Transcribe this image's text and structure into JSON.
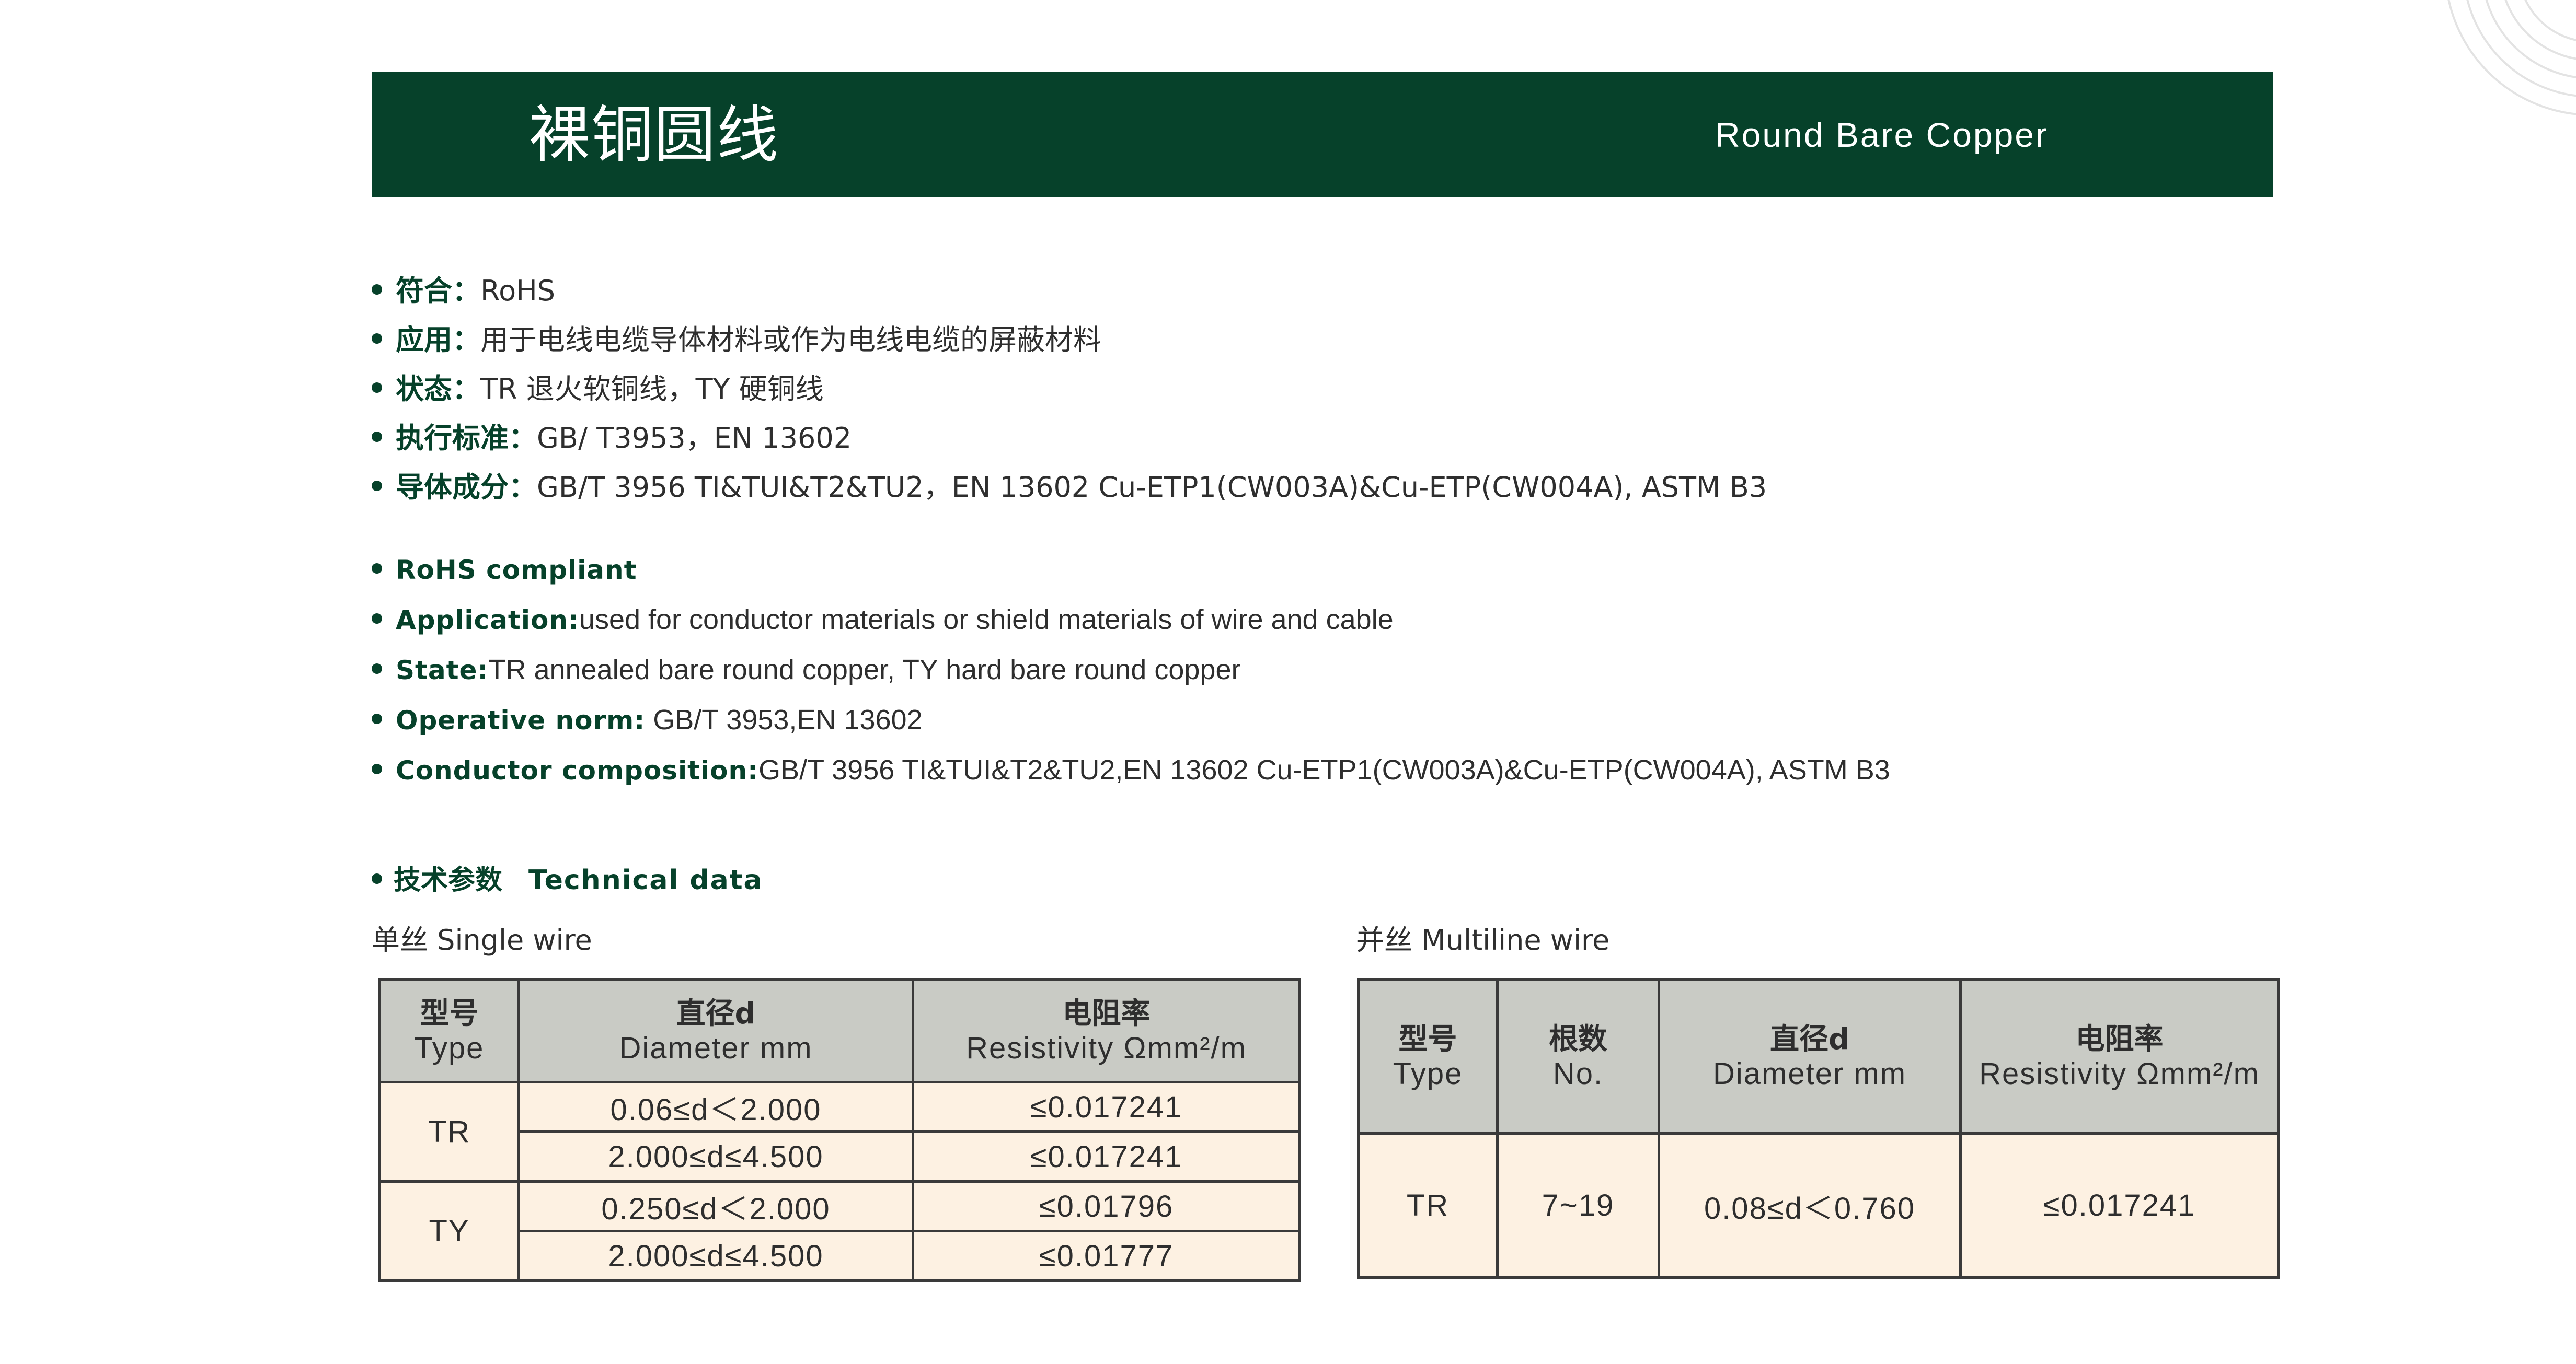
{
  "header": {
    "title_cn": "裸铜圆线",
    "title_en": "Round Bare Copper"
  },
  "cn_items": [
    {
      "label": "符合：",
      "value": "RoHS"
    },
    {
      "label": "应用：",
      "value": "用于电线电缆导体材料或作为电线电缆的屏蔽材料"
    },
    {
      "label": "状态：",
      "value": "TR 退火软铜线，TY 硬铜线"
    },
    {
      "label": "执行标准：",
      "value": "GB/ T3953，EN 13602"
    },
    {
      "label": "导体成分：",
      "value": "GB/T 3956 TI&TUI&T2&TU2，EN 13602 Cu-ETP1(CW003A)&Cu-ETP(CW004A), ASTM B3"
    }
  ],
  "en_items": [
    {
      "label": "RoHS compliant",
      "value": ""
    },
    {
      "label": "Application:",
      "value": "used for conductor materials or shield materials of wire and cable"
    },
    {
      "label": "State:",
      "value": "TR annealed bare round copper, TY hard bare round copper"
    },
    {
      "label": "Operative norm:",
      "value": " GB/T 3953,EN 13602"
    },
    {
      "label": "Conductor composition:",
      "value": "GB/T 3956 TI&TUI&T2&TU2,EN 13602 Cu-ETP1(CW003A)&Cu-ETP(CW004A), ASTM B3"
    }
  ],
  "tech_section": {
    "title_cn": "技术参数",
    "title_en": "Technical data"
  },
  "single_table": {
    "caption": "单丝 Single wire",
    "headers": [
      {
        "cn": "型号",
        "en": "Type"
      },
      {
        "cn": "直径d",
        "en": "Diameter  mm"
      },
      {
        "cn": "电阻率",
        "en": "Resistivity  Ωmm²/m"
      }
    ],
    "rows": [
      {
        "type": "TR",
        "diameter": "0.06≤d＜2.000",
        "resistivity": "≤0.017241"
      },
      {
        "type": "TR",
        "diameter": "2.000≤d≤4.500",
        "resistivity": "≤0.017241"
      },
      {
        "type": "TY",
        "diameter": "0.250≤d＜2.000",
        "resistivity": "≤0.01796"
      },
      {
        "type": "TY",
        "diameter": "2.000≤d≤4.500",
        "resistivity": "≤0.01777"
      }
    ]
  },
  "multi_table": {
    "caption": "并丝 Multiline wire",
    "headers": [
      {
        "cn": "型号",
        "en": "Type"
      },
      {
        "cn": "根数",
        "en": "No."
      },
      {
        "cn": "直径d",
        "en": "Diameter  mm"
      },
      {
        "cn": "电阻率",
        "en": "Resistivity  Ωmm²/m"
      }
    ],
    "rows": [
      {
        "type": "TR",
        "count": "7~19",
        "diameter": "0.08≤d＜0.760",
        "resistivity": "≤0.017241"
      }
    ]
  },
  "colors": {
    "brand_green": "#06412a",
    "header_cell": "#c9cbc5",
    "data_cell": "#fdf1e2"
  }
}
